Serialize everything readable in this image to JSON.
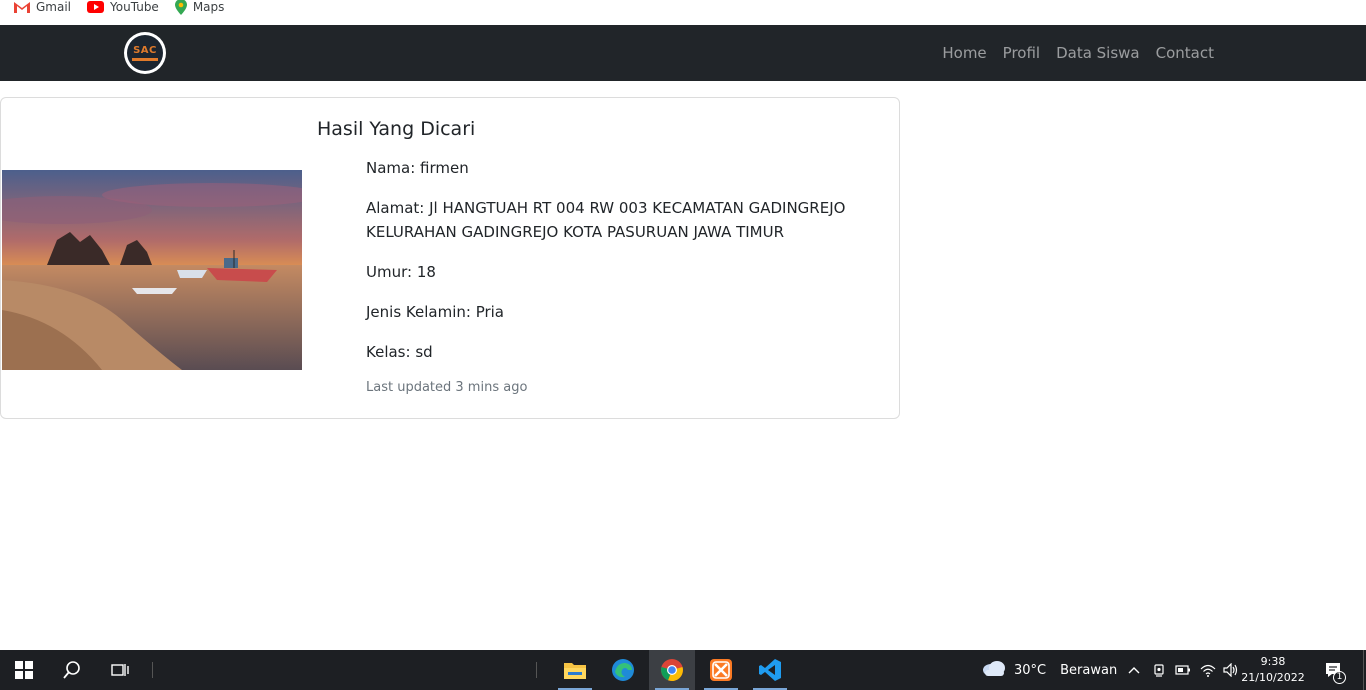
{
  "bookmarks": [
    {
      "label": "Gmail",
      "icon": "gmail-icon"
    },
    {
      "label": "YouTube",
      "icon": "youtube-icon"
    },
    {
      "label": "Maps",
      "icon": "maps-icon"
    }
  ],
  "navbar": {
    "logo_text": "SAC",
    "links": [
      "Home",
      "Profil",
      "Data Siswa",
      "Contact"
    ]
  },
  "card": {
    "title": "Hasil Yang Dicari",
    "image": "beach-sunset-image",
    "fields": [
      "Nama: firmen",
      "Alamat: Jl HANGTUAH RT 004 RW 003 KECAMATAN GADINGREJO KELURAHAN GADINGREJO KOTA PASURUAN JAWA TIMUR",
      "Umur: 18",
      "Jenis Kelamin: Pria",
      "Kelas: sd"
    ],
    "updated": "Last updated 3 mins ago"
  },
  "taskbar": {
    "apps": [
      "file-explorer-icon",
      "edge-icon",
      "chrome-icon",
      "xampp-icon",
      "vscode-icon"
    ],
    "active_app": "chrome-icon",
    "weather": {
      "temp": "30°C",
      "condition": "Berawan"
    },
    "clock": {
      "time": "9:38",
      "date": "21/10/2022"
    },
    "notification_count": "1"
  }
}
